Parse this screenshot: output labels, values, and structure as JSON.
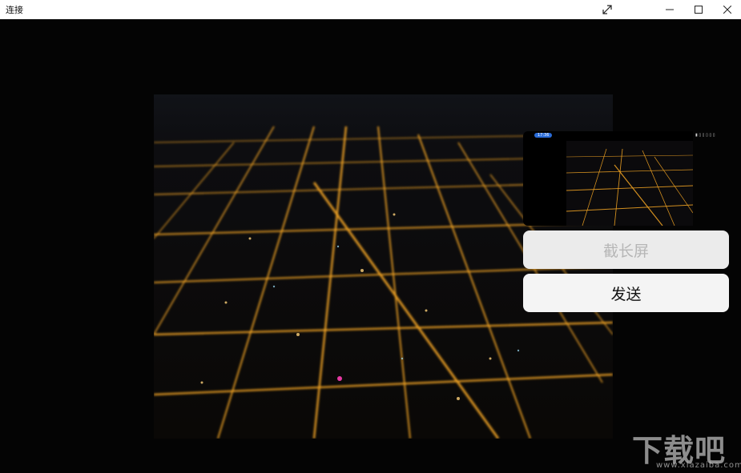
{
  "window": {
    "title": "连接"
  },
  "preview": {
    "status_left": "17:36",
    "status_right": "▮ ▯ ▯ ▯ ▯ ▯"
  },
  "actions": {
    "long_screenshot_label": "截长屏",
    "send_label": "发送"
  },
  "watermark": {
    "big": "下载吧",
    "small": "www.xiazaiba.com"
  },
  "colors": {
    "city_light": "#f5a623",
    "city_light_bright": "#ffd27a",
    "button_bg": "#f1f1f1",
    "disabled_text": "#b6b6b6"
  }
}
